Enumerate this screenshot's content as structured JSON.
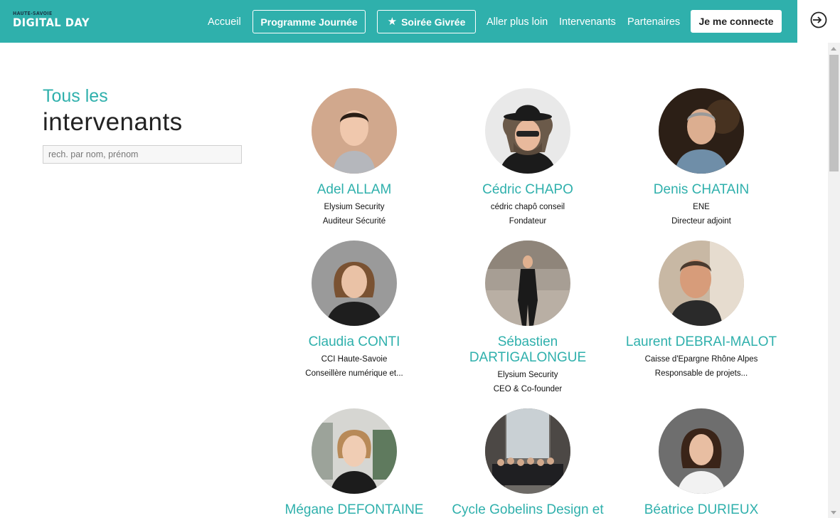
{
  "header": {
    "logo_small": "HAUTE-SAVOIE",
    "logo_big": "DIGITAL DAY",
    "nav": {
      "accueil": "Accueil",
      "programme": "Programme Journée",
      "soiree": "Soirée Givrée",
      "aller_plus_loin": "Aller plus loin",
      "intervenants": "Intervenants",
      "partenaires": "Partenaires",
      "connect": "Je me connecte"
    }
  },
  "colors": {
    "accent": "#2fb0ac"
  },
  "sidebar": {
    "title_line1": "Tous les",
    "title_line2": "intervenants",
    "search_placeholder": "rech. par nom, prénom"
  },
  "speakers": [
    {
      "name": "Adel ALLAM",
      "company": "Elysium Security",
      "role": "Auditeur Sécurité"
    },
    {
      "name": "Cédric CHAPO",
      "company": "cédric chapô conseil",
      "role": "Fondateur"
    },
    {
      "name": "Denis CHATAIN",
      "company": "ENE",
      "role": "Directeur adjoint"
    },
    {
      "name": "Claudia CONTI",
      "company": "CCI Haute-Savoie",
      "role": "Conseillère numérique et..."
    },
    {
      "name": "Sébastien DARTIGALONGUE",
      "company": "Elysium Security",
      "role": "CEO & Co-founder"
    },
    {
      "name": "Laurent DEBRAI-MALOT",
      "company": "Caisse d'Epargne Rhône Alpes",
      "role": "Responsable de projets..."
    },
    {
      "name": "Mégane DEFONTAINE",
      "company": "",
      "role": ""
    },
    {
      "name": "Cycle Gobelins Design et",
      "company": "",
      "role": ""
    },
    {
      "name": "Béatrice DURIEUX",
      "company": "",
      "role": ""
    }
  ]
}
